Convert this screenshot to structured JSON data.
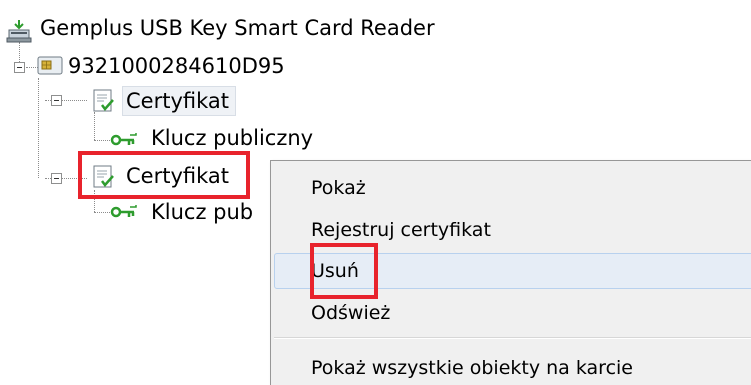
{
  "tree": {
    "reader_label": "Gemplus USB Key Smart Card Reader",
    "card_label": "9321000284610D95",
    "cert1_label": "Certyfikat",
    "key1_label": "Klucz publiczny",
    "cert2_label": "Certyfikat",
    "key2_label": "Klucz pub"
  },
  "context_menu": {
    "items": [
      {
        "label": "Pokaż"
      },
      {
        "label": "Rejestruj certyfikat"
      },
      {
        "label": "Usuń"
      },
      {
        "label": "Odśwież"
      },
      {
        "label": "Pokaż wszystkie obiekty na karcie"
      }
    ],
    "hovered_item": "Usuń"
  },
  "colors": {
    "highlight_red": "#e8232c",
    "menu_background": "#f0f0f0",
    "menu_hover": "#e6edf6",
    "key_icon_green": "#2e9c2e",
    "card_chip_gold": "#d6b23a"
  },
  "icons": {
    "reader": "card-reader-icon",
    "card": "smart-card-icon",
    "certificate": "certificate-icon",
    "key": "public-key-icon",
    "toggle": "collapse-minus-icon"
  }
}
